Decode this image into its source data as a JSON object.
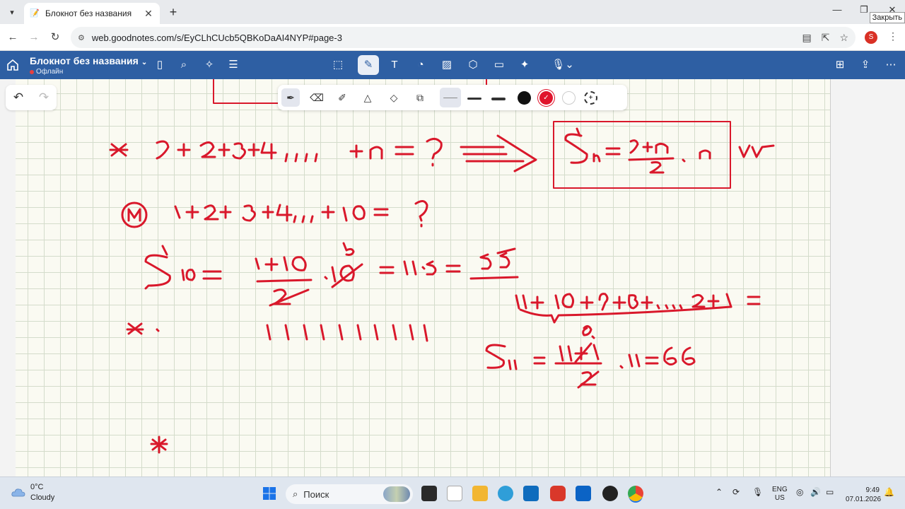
{
  "browser": {
    "tab_title": "Блокнот без названия",
    "url": "web.goodnotes.com/s/EyCLhCUcb5QBKoDaAI4NYP#page-3",
    "tooltip": "Закрыть",
    "profile_initial": "S"
  },
  "app": {
    "doc_title": "Блокнот без названия",
    "status": "Офлайн",
    "accent_color": "#2e5fa3",
    "ink_color": "#d9182b"
  },
  "pen_toolbar": {
    "tools": [
      "pen-icon",
      "eraser-icon",
      "highlighter-icon",
      "shape-icon",
      "lasso-icon",
      "elements-icon"
    ],
    "colors": [
      "#111111",
      "#e0142c",
      "#ffffff"
    ]
  },
  "handwriting": {
    "line1": "* 1 + 2 + 3 + 4 , , , + n = ? ⟹",
    "formula_box": "Sn = (1+n)/2 · n",
    "note": "vv",
    "example_label": "M",
    "line2": "1 + 2 + 3 + 4 , , , + 10 = ?",
    "s10": "S10 = (1+10)/2 · 10 = 11·5 = 55",
    "reverse_sum": "11 + 10 + 9 + 8 + ... 2 + 1 =",
    "ones": "1 1 1 1 1 1 1 1 1 1",
    "s11": "S11 = (11+1)/2 · 11 = 66"
  },
  "taskbar": {
    "temperature": "0°C",
    "weather": "Cloudy",
    "search_placeholder": "Поиск",
    "lang_top": "ENG",
    "lang_bottom": "US",
    "time": "9:49",
    "date": "07.01.2026"
  }
}
